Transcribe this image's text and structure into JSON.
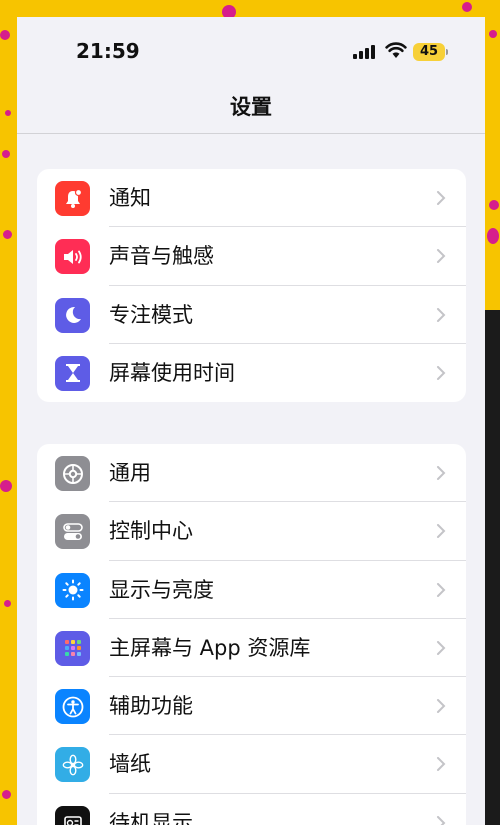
{
  "status_bar": {
    "time": "21:59",
    "battery": "45",
    "icons": [
      "cellular-signal-icon",
      "wifi-icon",
      "battery-icon"
    ]
  },
  "nav": {
    "title": "设置"
  },
  "colors": {
    "notifications": "#ff3b30",
    "sounds": "#ff2d55",
    "focus": "#5e5ce6",
    "screen_time": "#5e5ce6",
    "general": "#8e8e93",
    "control_center": "#8e8e93",
    "display": "#0a84ff",
    "home_screen": "#5e5ce6",
    "accessibility": "#0a84ff",
    "wallpaper": "#32ade6",
    "standby": "#111111"
  },
  "groups": [
    {
      "items": [
        {
          "label": "通知",
          "icon": "notification-bell-icon"
        },
        {
          "label": "声音与触感",
          "icon": "speaker-icon"
        },
        {
          "label": "专注模式",
          "icon": "moon-icon"
        },
        {
          "label": "屏幕使用时间",
          "icon": "hourglass-icon"
        }
      ]
    },
    {
      "items": [
        {
          "label": "通用",
          "icon": "gear-icon"
        },
        {
          "label": "控制中心",
          "icon": "toggle-switches-icon"
        },
        {
          "label": "显示与亮度",
          "icon": "sun-icon"
        },
        {
          "label": "主屏幕与 App 资源库",
          "icon": "app-grid-icon"
        },
        {
          "label": "辅助功能",
          "icon": "accessibility-icon"
        },
        {
          "label": "墙纸",
          "icon": "flower-icon"
        },
        {
          "label": "待机显示",
          "icon": "standby-icon"
        }
      ]
    }
  ]
}
